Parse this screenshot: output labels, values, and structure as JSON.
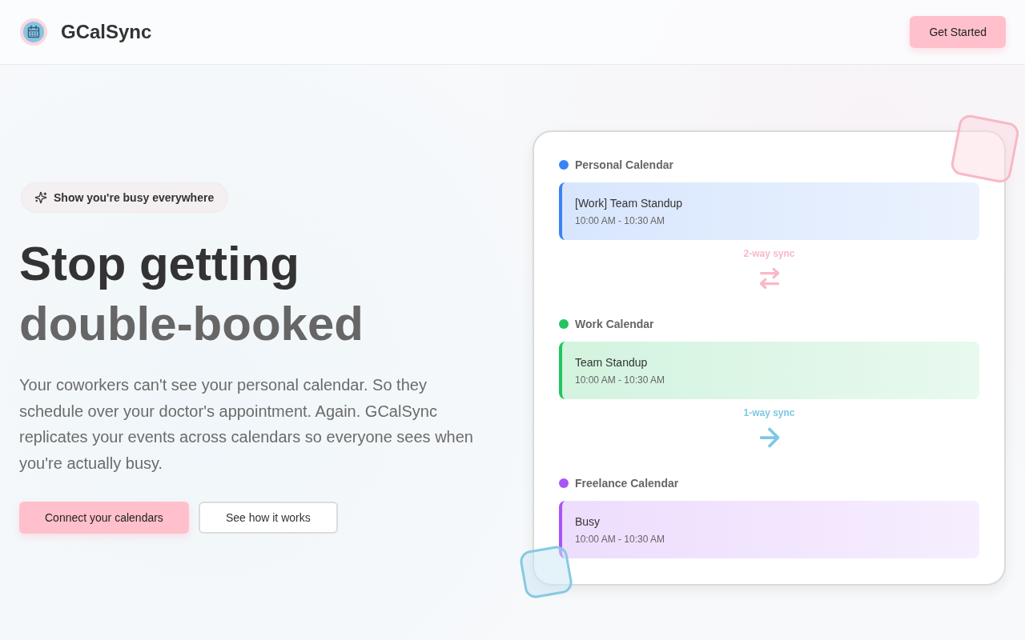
{
  "header": {
    "brand": "GCalSync",
    "button": "Get Started"
  },
  "hero": {
    "badge": "Show you're busy everywhere",
    "headline": [
      {
        "text": "Stop getting",
        "color": "#333333"
      },
      {
        "text": "double-booked",
        "color": "#666666"
      }
    ],
    "description": "Your coworkers can't see your personal calendar. So they schedule over your doctor's appointment. Again. GCalSync replicates your events across calendars so everyone sees when you're actually busy.",
    "buttons": [
      {
        "label": "Connect your calendars",
        "kind": "primary"
      },
      {
        "label": "See how it works",
        "kind": "secondary"
      }
    ]
  },
  "preview": {
    "items": [
      {
        "kind": "calendar",
        "name": "Personal Calendar",
        "color": "#3b82f6",
        "event": {
          "title": "[Work] Team Standup",
          "time": "10:00 AM - 10:30 AM"
        }
      },
      {
        "kind": "sync",
        "label": "2-way sync",
        "bidirectional": true,
        "color": "#f9b8c8"
      },
      {
        "kind": "calendar",
        "name": "Work Calendar",
        "color": "#22c55e",
        "event": {
          "title": "Team Standup",
          "time": "10:00 AM - 10:30 AM"
        }
      },
      {
        "kind": "sync",
        "label": "1-way sync",
        "bidirectional": false,
        "color": "#7ec8e3"
      },
      {
        "kind": "calendar",
        "name": "Freelance Calendar",
        "color": "#a855f7",
        "event": {
          "title": "Busy",
          "time": "10:00 AM - 10:30 AM"
        }
      }
    ]
  }
}
